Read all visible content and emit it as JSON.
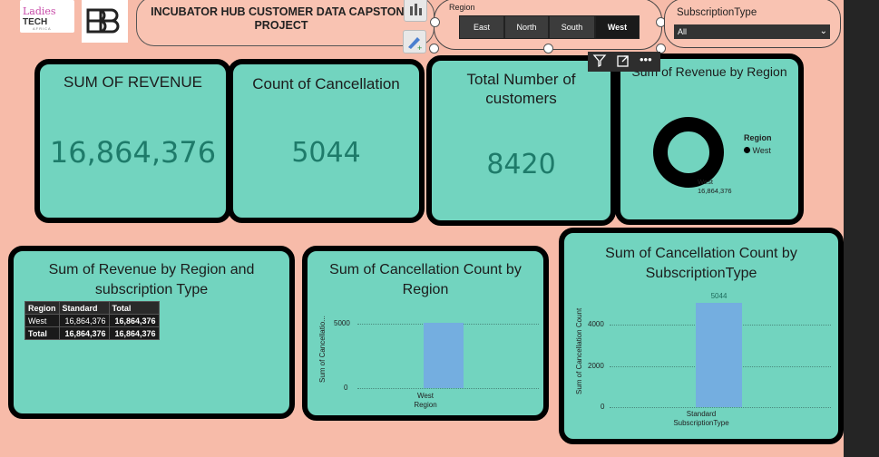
{
  "header": {
    "logo_ladies_line1": "Ladies",
    "logo_ladies_line2": "TECH",
    "logo_ladies_line3": "AFRICA",
    "logo_bb": "BB",
    "title": "INCUBATOR HUB CUSTOMER DATA CAPSTONE PROJECT"
  },
  "region_slicer": {
    "label": "Region",
    "options": [
      "East",
      "North",
      "South",
      "West"
    ],
    "selected": "West"
  },
  "subscription_slicer": {
    "label": "SubscriptionType",
    "value": "All"
  },
  "kpis": {
    "revenue_title": "SUM OF REVENUE",
    "revenue_value": "16,864,376",
    "cancellation_title": "Count of Cancellation",
    "cancellation_value": "5044",
    "customers_title": "Total Number of customers",
    "customers_value": "8420"
  },
  "donut": {
    "title": "Sum of Revenue by Region",
    "legend_title": "Region",
    "legend_item": "West",
    "label_name": "West",
    "label_value": "16,864,376"
  },
  "matrix": {
    "title": "Sum of Revenue by Region and subscription Type",
    "headers": [
      "Region",
      "Standard",
      "Total"
    ],
    "rows": [
      [
        "West",
        "16,864,376",
        "16,864,376"
      ],
      [
        "Total",
        "16,864,376",
        "16,864,376"
      ]
    ]
  },
  "chart_data": [
    {
      "type": "bar",
      "title": "Sum of Cancellation Count by Region",
      "categories": [
        "West"
      ],
      "values": [
        5044
      ],
      "xlabel": "Region",
      "ylabel": "Sum of Cancellatio...",
      "ylim": [
        0,
        5000
      ],
      "yticks": [
        "5000",
        "0"
      ]
    },
    {
      "type": "bar",
      "title": "Sum of Cancellation Count by SubscriptionType",
      "categories": [
        "Standard"
      ],
      "values": [
        5044
      ],
      "data_label": "5044",
      "xlabel": "SubscriptionType",
      "ylabel": "Sum of Cancellation Count",
      "ylim": [
        0,
        5000
      ],
      "yticks": [
        "4000",
        "2000",
        "0"
      ]
    }
  ],
  "colors": {
    "background": "#f7bba9",
    "card": "#72d4bf",
    "kpi_text": "#1e7b6a",
    "bar": "#74aee0"
  }
}
